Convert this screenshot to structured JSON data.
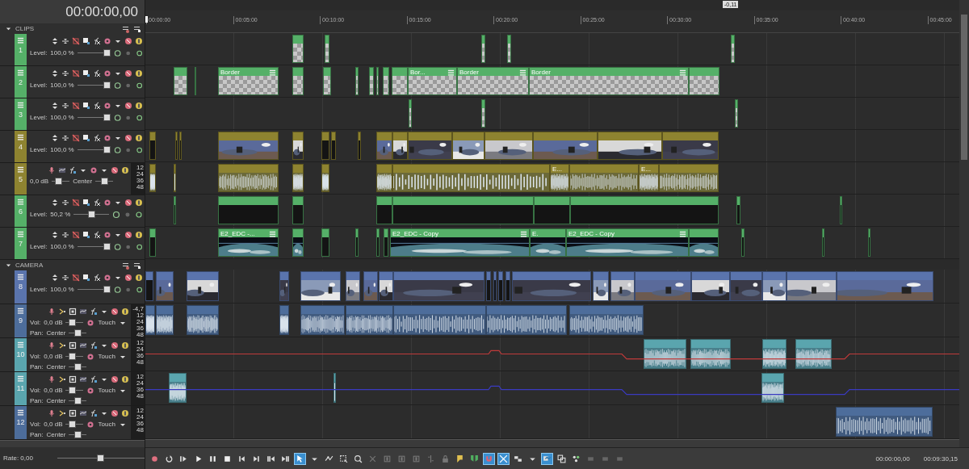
{
  "time_display": "00:00:00,00",
  "marker": "-0,11",
  "ruler": [
    "00:00:00",
    "00:05:00",
    "00:10:00",
    "00:15:00",
    "00:20:00",
    "00:25:00",
    "00:30:00",
    "00:35:00",
    "00:40:00",
    "00:45:00"
  ],
  "groups": [
    {
      "name": "CLIPS",
      "expanded": true,
      "tracks": [
        {
          "number": "1",
          "kind": "video",
          "color": "#55b068",
          "level_label": "Level:",
          "slider": {
            "reading": "100,0 %",
            "level": 1
          }
        },
        {
          "number": "2",
          "kind": "video",
          "color": "#55b068",
          "level_label": "Level:",
          "slider": {
            "reading": "100,0 %",
            "level": 1
          },
          "clips": [
            {
              "label": "Border"
            },
            {
              "label": "Bor..."
            },
            {
              "label": "Border"
            },
            {
              "label": "Border"
            }
          ]
        },
        {
          "number": "3",
          "kind": "video",
          "color": "#55b068",
          "level_label": "Level:",
          "slider": {
            "reading": "100,0 %",
            "level": 1
          }
        },
        {
          "number": "4",
          "kind": "video",
          "color": "#8e8330",
          "level_label": "Level:",
          "slider": {
            "reading": "100,0 %",
            "level": 1
          }
        },
        {
          "number": "5",
          "kind": "audio_small",
          "color": "#8e8330",
          "volume": {
            "reading": "0,0 dB",
            "level": 0.3
          },
          "pan": {
            "reading": "Center",
            "level": 0.5
          },
          "meter_labels": [
            "12",
            "24",
            "36",
            "48"
          ],
          "clips": [
            {
              "label": "E..."
            },
            {
              "label": "E..."
            }
          ]
        },
        {
          "number": "6",
          "kind": "video",
          "color": "#55b068",
          "level_label": "Level:",
          "slider": {
            "reading": "50,2 %",
            "level": 0.5
          }
        },
        {
          "number": "7",
          "kind": "video",
          "color": "#55b068",
          "level_label": "Level:",
          "slider": {
            "reading": "100,0 %",
            "level": 1
          },
          "clips": [
            {
              "label": "E2_EDC -..."
            },
            {
              "label": "E2_EDC - Copy"
            },
            {
              "label": "E."
            },
            {
              "label": "E2_EDC - Copy"
            }
          ]
        }
      ]
    },
    {
      "name": "CAMERA",
      "expanded": true,
      "tracks": [
        {
          "number": "8",
          "kind": "video",
          "color": "#5a74ad",
          "level_label": "Level:",
          "slider": {
            "reading": "100,0 %",
            "level": 1
          }
        },
        {
          "number": "9",
          "kind": "audio",
          "color": "#4d6d9b",
          "volume": {
            "label": "Vol:",
            "reading": "0,0 dB",
            "level": 0.3
          },
          "automation": "Touch",
          "pan": {
            "label": "Pan:",
            "reading": "Center",
            "level": 0.5
          },
          "peak": "-4,7",
          "meter_labels": [
            "12",
            "24",
            "36",
            "48"
          ]
        },
        {
          "number": "10",
          "kind": "audio",
          "color": "#5aa5ae",
          "volume": {
            "label": "Vol:",
            "reading": "0,0 dB",
            "level": 0.3
          },
          "automation": "Touch",
          "pan": {
            "label": "Pan:",
            "reading": "Center",
            "level": 0.5
          },
          "meter_labels": [
            "12",
            "24",
            "36",
            "48"
          ]
        },
        {
          "number": "11",
          "kind": "audio",
          "color": "#5aa5ae",
          "volume": {
            "label": "Vol:",
            "reading": "0,0 dB",
            "level": 0.3
          },
          "automation": "Touch",
          "pan": {
            "label": "Pan:",
            "reading": "Center",
            "level": 0.5
          },
          "meter_labels": [
            "12",
            "24",
            "36",
            "48"
          ]
        },
        {
          "number": "12",
          "kind": "audio",
          "color": "#4d6d9b",
          "volume": {
            "label": "Vol:",
            "reading": "0,0 dB",
            "level": 0.3
          },
          "automation": "Touch",
          "pan": {
            "label": "Pan:",
            "reading": "Center",
            "level": 0.5
          },
          "meter_labels": [
            "12",
            "24",
            "36",
            "48"
          ]
        }
      ]
    }
  ],
  "rate": {
    "label": "Rate: 0,00",
    "level": 0.5
  },
  "toolbar": {
    "buttons": [
      {
        "kind": "record",
        "on": false
      },
      {
        "kind": "loop",
        "on": false
      },
      {
        "kind": "play_start",
        "on": false
      },
      {
        "kind": "play",
        "on": false
      },
      {
        "kind": "pause",
        "on": false
      },
      {
        "kind": "stop",
        "on": false
      },
      {
        "kind": "go_start",
        "on": false
      },
      {
        "kind": "go_end",
        "on": false
      },
      {
        "kind": "prev_frame",
        "on": false
      },
      {
        "kind": "next_frame",
        "on": false
      },
      {
        "kind": "edit_tool",
        "on": true
      },
      {
        "kind": "caret",
        "on": false
      },
      {
        "kind": "envelope_tool",
        "on": false
      },
      {
        "kind": "selection_tool",
        "on": false
      },
      {
        "kind": "zoom_tool",
        "on": false
      },
      {
        "kind": "delete",
        "on": false
      },
      {
        "kind": "trim",
        "on": false
      },
      {
        "kind": "trim",
        "on": false
      },
      {
        "kind": "trim",
        "on": false
      },
      {
        "kind": "split",
        "on": false
      },
      {
        "kind": "lock",
        "on": false
      },
      {
        "kind": "marker",
        "on": false
      },
      {
        "kind": "region",
        "on": false
      },
      {
        "kind": "snap",
        "on": true
      },
      {
        "kind": "crossfade",
        "on": true
      },
      {
        "kind": "ripple",
        "on": false
      },
      {
        "kind": "caret",
        "on": false
      },
      {
        "kind": "lock_envelope",
        "on": true
      },
      {
        "kind": "grouping",
        "on": false
      },
      {
        "kind": "events",
        "on": false
      },
      {
        "kind": "generic",
        "on": false
      },
      {
        "kind": "generic",
        "on": false
      },
      {
        "kind": "generic",
        "on": false
      }
    ],
    "cursor_time": "00:00:00,00",
    "length_time": "00:09:30,15"
  }
}
